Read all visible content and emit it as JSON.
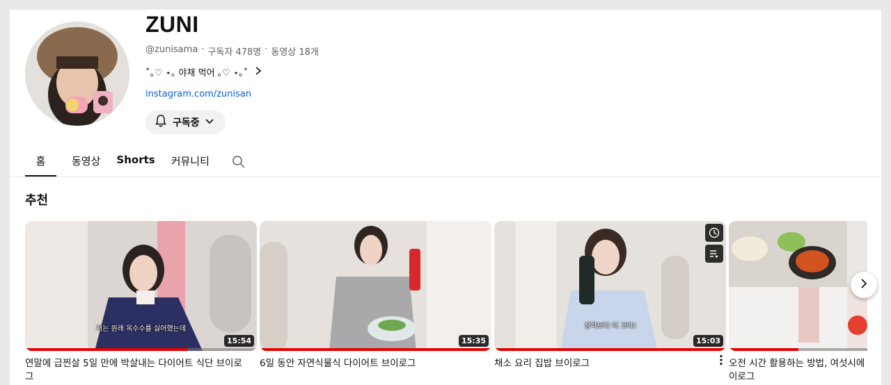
{
  "channel": {
    "name": "ZUNI",
    "handle": "@zunisama",
    "sep": "·",
    "subscribers": "구독자 478명",
    "videos_count": "동영상 18개",
    "description": "˚｡♡ ⋆｡ 야채 먹어 ｡♡ ⋆｡˚",
    "link": "instagram.com/zunisan",
    "subscribe_label": "구독중"
  },
  "tabs": [
    "홈",
    "동영상",
    "Shorts",
    "커뮤니티"
  ],
  "section_title": "추천",
  "videos": [
    {
      "title": "연말에 급찐살 5일 만에 박살내는 다이어트 식단 브이로그",
      "duration": "15:54",
      "caption": "저는 원래 옥수수를 싫어했는데",
      "progress": 0.7
    },
    {
      "title": "6일 동안 자연식물식 다이어트 브이로그",
      "duration": "15:35",
      "caption": "",
      "progress": 1.0
    },
    {
      "title": "채소 요리 집밥 브이로그",
      "duration": "15:03",
      "caption": "생각보다 더 크다!",
      "progress": 1.0
    },
    {
      "title": "오전 시간 활용하는 방법, 여섯시에 일어나는 모닝루틴 브이로그",
      "duration": "",
      "caption": "",
      "progress": 0.3
    }
  ],
  "colors": {
    "accent_red": "#e60000",
    "link_blue": "#065fd4",
    "text": "#0f0f0f",
    "muted": "#606060"
  },
  "icons": [
    "bell-icon",
    "chevron-down-icon",
    "chevron-right-icon",
    "search-icon",
    "clock-icon",
    "playlist-add-icon",
    "more-vert-icon"
  ]
}
